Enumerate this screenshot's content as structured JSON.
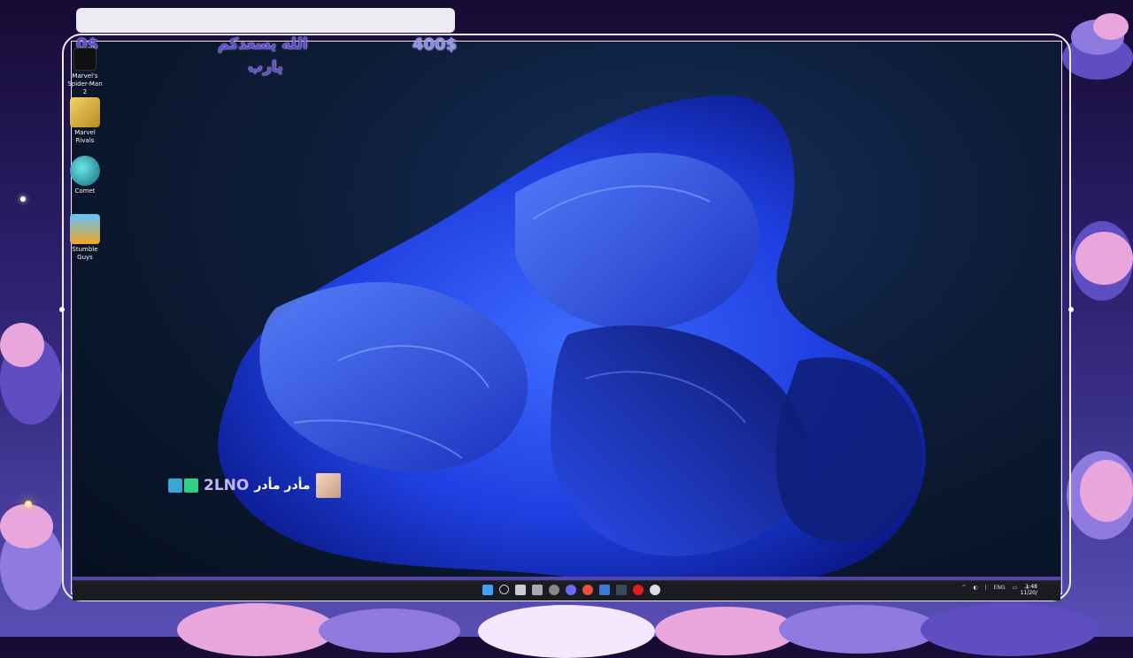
{
  "overlay": {
    "top_left_amount": "0$",
    "arabic_line1": "الله يسعدكم",
    "arabic_line2": "يارب",
    "goal_amount": "400$"
  },
  "desktop_icons": [
    {
      "label": "Marvel's Spider-Man 2",
      "icon": "spider-man-icon"
    },
    {
      "label": "Marvel Rivals",
      "icon": "marvel-rivals-icon"
    },
    {
      "label": "Comet",
      "icon": "comet-icon"
    },
    {
      "label": "Stumble Guys",
      "icon": "stumble-guys-icon"
    }
  ],
  "streamer_tag": {
    "name": "2LNO",
    "arabic": "مأدر مأدر"
  },
  "taskbar": {
    "lang": "ENG",
    "time": "1:48",
    "date": "11/20/"
  },
  "colors": {
    "accent": "#5e48d8",
    "wallpaper_blue": "#2447e6"
  }
}
